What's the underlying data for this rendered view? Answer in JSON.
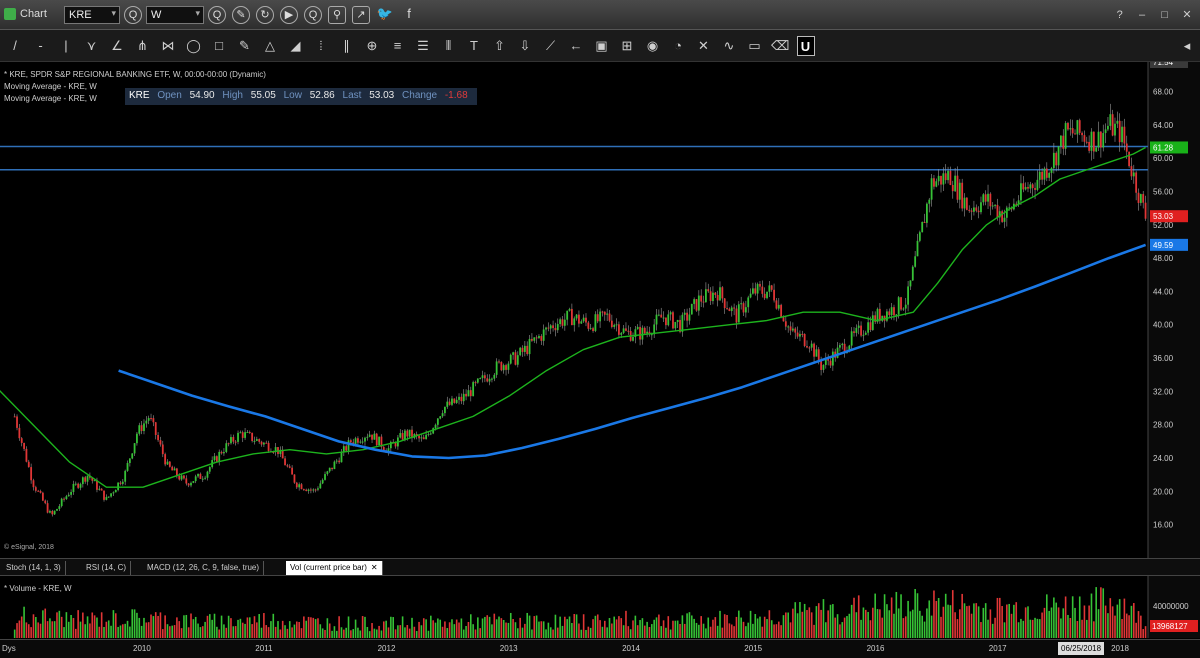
{
  "window": {
    "title": "Chart",
    "symbol": "KRE",
    "interval": "W",
    "controls": [
      "?",
      "–",
      "□",
      "✕"
    ]
  },
  "titlebar_tools": [
    {
      "name": "symbol-lookup-icon",
      "glyph": "Q"
    },
    {
      "name": "interval-lookup-icon",
      "glyph": "Q"
    },
    {
      "name": "edit-icon",
      "glyph": "✎"
    },
    {
      "name": "refresh-icon",
      "glyph": "↻"
    },
    {
      "name": "play-icon",
      "glyph": "▶"
    },
    {
      "name": "search-icon",
      "glyph": "Q"
    },
    {
      "name": "link-icon",
      "glyph": "⚲"
    },
    {
      "name": "share-icon",
      "glyph": "↗"
    },
    {
      "name": "twitter-icon",
      "glyph": "🐦"
    },
    {
      "name": "facebook-icon",
      "glyph": "f"
    }
  ],
  "drawing_tools": [
    {
      "name": "trendline-tool-icon",
      "glyph": "/"
    },
    {
      "name": "ray-tool-icon",
      "glyph": "-"
    },
    {
      "name": "vertical-line-tool-icon",
      "glyph": "|"
    },
    {
      "name": "zigzag-tool-icon",
      "glyph": "⋎"
    },
    {
      "name": "angle-tool-icon",
      "glyph": "∠"
    },
    {
      "name": "pitchfork-tool-icon",
      "glyph": "⋔"
    },
    {
      "name": "fan-tool-icon",
      "glyph": "⋈"
    },
    {
      "name": "ellipse-tool-icon",
      "glyph": "◯"
    },
    {
      "name": "rectangle-tool-icon",
      "glyph": "□"
    },
    {
      "name": "pencil-tool-icon",
      "glyph": "✎"
    },
    {
      "name": "triangle-tool-icon",
      "glyph": "△"
    },
    {
      "name": "brush-tool-icon",
      "glyph": "◢"
    },
    {
      "name": "cycle-lines-tool-icon",
      "glyph": "⦙"
    },
    {
      "name": "parallel-channel-tool-icon",
      "glyph": "∥"
    },
    {
      "name": "globe-tool-icon",
      "glyph": "⊕"
    },
    {
      "name": "fib-retracement-tool-icon",
      "glyph": "≡"
    },
    {
      "name": "fib-extension-tool-icon",
      "glyph": "☰"
    },
    {
      "name": "fib-timezone-tool-icon",
      "glyph": "⦀"
    },
    {
      "name": "text-tool-icon",
      "glyph": "T"
    },
    {
      "name": "marker-up-tool-icon",
      "glyph": "⇧"
    },
    {
      "name": "marker-down-tool-icon",
      "glyph": "⇩"
    },
    {
      "name": "regression-tool-icon",
      "glyph": "⟋"
    },
    {
      "name": "arrow-tool-icon",
      "glyph": "←"
    },
    {
      "name": "box-tool-icon",
      "glyph": "▣"
    },
    {
      "name": "measure-tool-icon",
      "glyph": "⊞"
    },
    {
      "name": "eye-tool-icon",
      "glyph": "◉"
    },
    {
      "name": "oval-tool-icon",
      "glyph": "◔"
    },
    {
      "name": "cross-tool-icon",
      "glyph": "✕"
    },
    {
      "name": "snake-tool-icon",
      "glyph": "∿"
    },
    {
      "name": "comment-tool-icon",
      "glyph": "▭"
    },
    {
      "name": "eraser-tool-icon",
      "glyph": "⌫"
    },
    {
      "name": "underline-tool-icon",
      "glyph": "U"
    }
  ],
  "legend": {
    "series_line": "* KRE, SPDR S&P REGIONAL BANKING ETF, W, 00:00-00:00 (Dynamic)",
    "ma1_line": "Moving Average - KRE, W",
    "ma2_line": "Moving Average - KRE, W"
  },
  "quote": {
    "symbol": "KRE",
    "open_label": "Open",
    "open": "54.90",
    "high_label": "High",
    "high": "55.05",
    "low_label": "Low",
    "low": "52.86",
    "last_label": "Last",
    "last": "53.03",
    "change_label": "Change",
    "change": "-1.68"
  },
  "copyright": "© eSignal, 2018",
  "axis_badges": {
    "top": "71.54",
    "ma_fast": "61.28",
    "last": "53.03",
    "ma_slow": "49.59"
  },
  "indicator_tabs": [
    {
      "label": "Stoch (14, 1, 3)",
      "active": false
    },
    {
      "label": "RSI (14, C)",
      "active": false
    },
    {
      "label": "MACD (12, 26, C, 9, false, true)",
      "active": false
    },
    {
      "label": "Vol (current price bar)",
      "active": true
    }
  ],
  "volume": {
    "legend": "* Volume - KRE, W",
    "axis_label": "40000000",
    "last_badge": "13968127"
  },
  "date_axis": {
    "prefix": "Dys",
    "cursor_date": "06/25/2018"
  },
  "colors": {
    "ma_fast": "#1db31d",
    "ma_slow": "#1a78e6",
    "up_candle": "#36c236",
    "down_candle": "#e03636",
    "resistance": "#2f6fb8",
    "axis_text": "#cfcfcf"
  },
  "chart_data": {
    "type": "candlestick",
    "title": "KRE, SPDR S&P REGIONAL BANKING ETF, W",
    "ylim": [
      12,
      71.54
    ],
    "y_ticks": [
      16,
      20,
      24,
      28,
      32,
      36,
      40,
      44,
      48,
      52,
      56,
      60,
      64,
      68
    ],
    "x_ticks": [
      "2010",
      "2011",
      "2012",
      "2013",
      "2014",
      "2015",
      "2016",
      "2017",
      "2018"
    ],
    "resistance_levels": [
      61.4,
      58.6
    ],
    "series": [
      {
        "name": "KRE close (weekly, approx.)",
        "x": [
          2009.45,
          2009.6,
          2009.75,
          2009.9,
          2010.05,
          2010.2,
          2010.35,
          2010.45,
          2010.55,
          2010.7,
          2010.85,
          2011.0,
          2011.15,
          2011.3,
          2011.45,
          2011.6,
          2011.75,
          2011.9,
          2012.05,
          2012.2,
          2012.35,
          2012.5,
          2012.65,
          2012.8,
          2012.95,
          2013.1,
          2013.25,
          2013.4,
          2013.55,
          2013.7,
          2013.85,
          2014.0,
          2014.15,
          2014.3,
          2014.45,
          2014.6,
          2014.75,
          2014.9,
          2015.05,
          2015.2,
          2015.35,
          2015.5,
          2015.65,
          2015.8,
          2015.95,
          2016.05,
          2016.2,
          2016.35,
          2016.5,
          2016.65,
          2016.75,
          2016.85,
          2016.95,
          2017.1,
          2017.25,
          2017.4,
          2017.55,
          2017.7,
          2017.85,
          2017.95,
          2018.05,
          2018.15,
          2018.3,
          2018.4,
          2018.5,
          2018.6,
          2018.7
        ],
        "values": [
          29,
          21,
          17,
          20,
          22,
          19,
          22,
          27,
          29,
          23,
          21,
          22,
          25,
          27,
          26,
          25,
          21,
          20,
          23,
          26,
          27,
          25,
          27,
          26,
          30,
          31,
          33,
          35,
          36,
          38,
          40,
          41,
          40,
          41,
          39,
          39,
          41,
          40,
          43,
          44,
          41,
          44,
          44,
          39,
          38,
          35,
          37,
          39,
          41,
          42,
          43,
          50,
          57,
          58,
          54,
          55,
          53,
          56,
          58,
          60,
          63,
          63,
          62,
          64,
          63,
          58,
          53
        ]
      },
      {
        "name": "Moving Average (fast)",
        "x": [
          2009.3,
          2009.6,
          2009.9,
          2010.2,
          2010.5,
          2010.8,
          2011.1,
          2011.4,
          2011.7,
          2012.0,
          2012.3,
          2012.6,
          2012.9,
          2013.2,
          2013.5,
          2013.8,
          2014.1,
          2014.4,
          2014.7,
          2015.0,
          2015.3,
          2015.6,
          2015.9,
          2016.2,
          2016.5,
          2016.8,
          2017.0,
          2017.2,
          2017.4,
          2017.6,
          2017.8,
          2018.0,
          2018.2,
          2018.4,
          2018.6,
          2018.7
        ],
        "values": [
          32.5,
          28,
          23.5,
          20.5,
          20.5,
          22,
          23.5,
          24.5,
          25,
          24.5,
          25,
          26,
          27.5,
          29,
          31.5,
          34.5,
          37,
          38.5,
          39,
          39.5,
          40,
          40.5,
          41.5,
          41.5,
          40.5,
          41.5,
          45,
          49,
          52,
          54,
          55.5,
          57.5,
          58.5,
          59.5,
          60.5,
          61.28
        ]
      },
      {
        "name": "Moving Average (slow)",
        "x": [
          2010.3,
          2010.6,
          2010.9,
          2011.2,
          2011.5,
          2011.8,
          2012.1,
          2012.4,
          2012.7,
          2013.0,
          2013.3,
          2013.6,
          2013.9,
          2014.2,
          2014.5,
          2014.8,
          2015.1,
          2015.4,
          2015.7,
          2016.0,
          2016.3,
          2016.6,
          2016.9,
          2017.2,
          2017.5,
          2017.8,
          2018.1,
          2018.4,
          2018.7
        ],
        "values": [
          34.5,
          33,
          31.5,
          30.2,
          29,
          27.5,
          26,
          25,
          24.2,
          24,
          24.3,
          25.2,
          26.3,
          27.5,
          28.8,
          30,
          31.2,
          32.5,
          34,
          35.5,
          37,
          38.5,
          40,
          41.5,
          43,
          44.6,
          46.3,
          48,
          49.59
        ]
      },
      {
        "name": "Volume (millions, approx.)",
        "x": [
          2009.5,
          2010.0,
          2010.5,
          2011.0,
          2011.5,
          2012.0,
          2012.5,
          2013.0,
          2013.5,
          2014.0,
          2014.5,
          2015.0,
          2015.5,
          2016.0,
          2016.5,
          2017.0,
          2017.5,
          2018.0,
          2018.5,
          2018.7
        ],
        "values": [
          22,
          18,
          20,
          16,
          18,
          15,
          14,
          15,
          17,
          16,
          18,
          17,
          20,
          26,
          30,
          34,
          28,
          30,
          36,
          14
        ]
      }
    ]
  }
}
